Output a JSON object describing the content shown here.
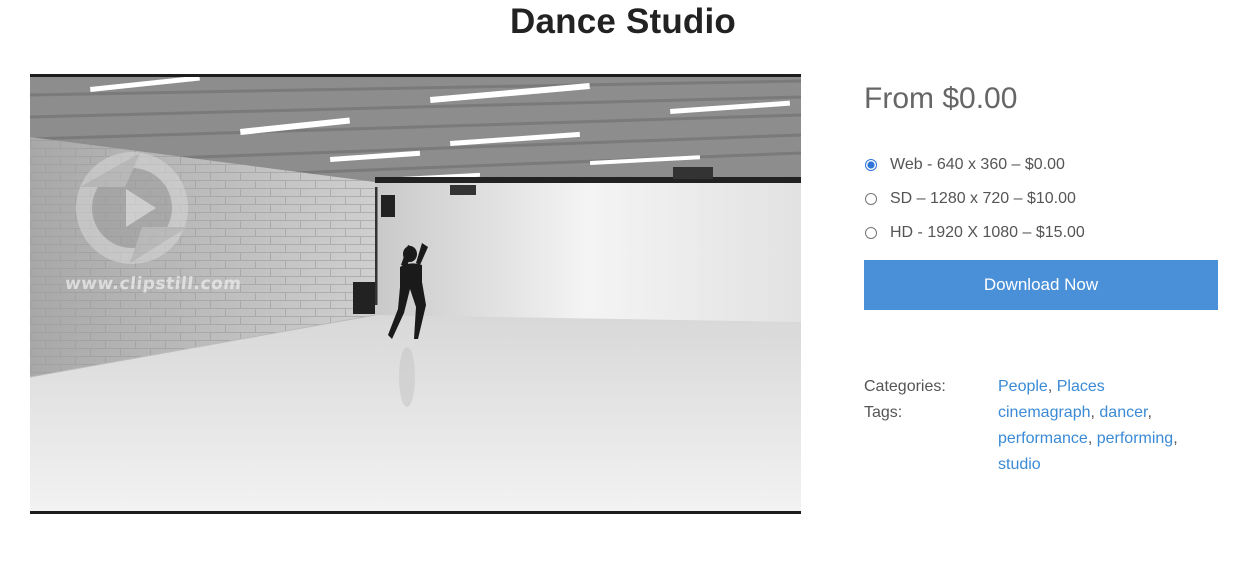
{
  "product": {
    "title": "Dance Studio",
    "price": "From $0.00",
    "watermark": "www.clipstill.com"
  },
  "options": [
    {
      "label": "Web - 640 x 360 – $0.00",
      "selected": true
    },
    {
      "label": "SD – 1280 x 720 – $10.00",
      "selected": false
    },
    {
      "label": "HD - 1920 X 1080 – $15.00",
      "selected": false
    }
  ],
  "download_label": "Download Now",
  "meta": {
    "categories_label": "Categories:",
    "categories": [
      "People",
      "Places"
    ],
    "tags_label": "Tags:",
    "tags": [
      "cinemagraph",
      "dancer",
      "performance",
      "performing",
      "studio"
    ]
  },
  "colors": {
    "accent": "#4a90d9",
    "link": "#3a8ad6"
  }
}
